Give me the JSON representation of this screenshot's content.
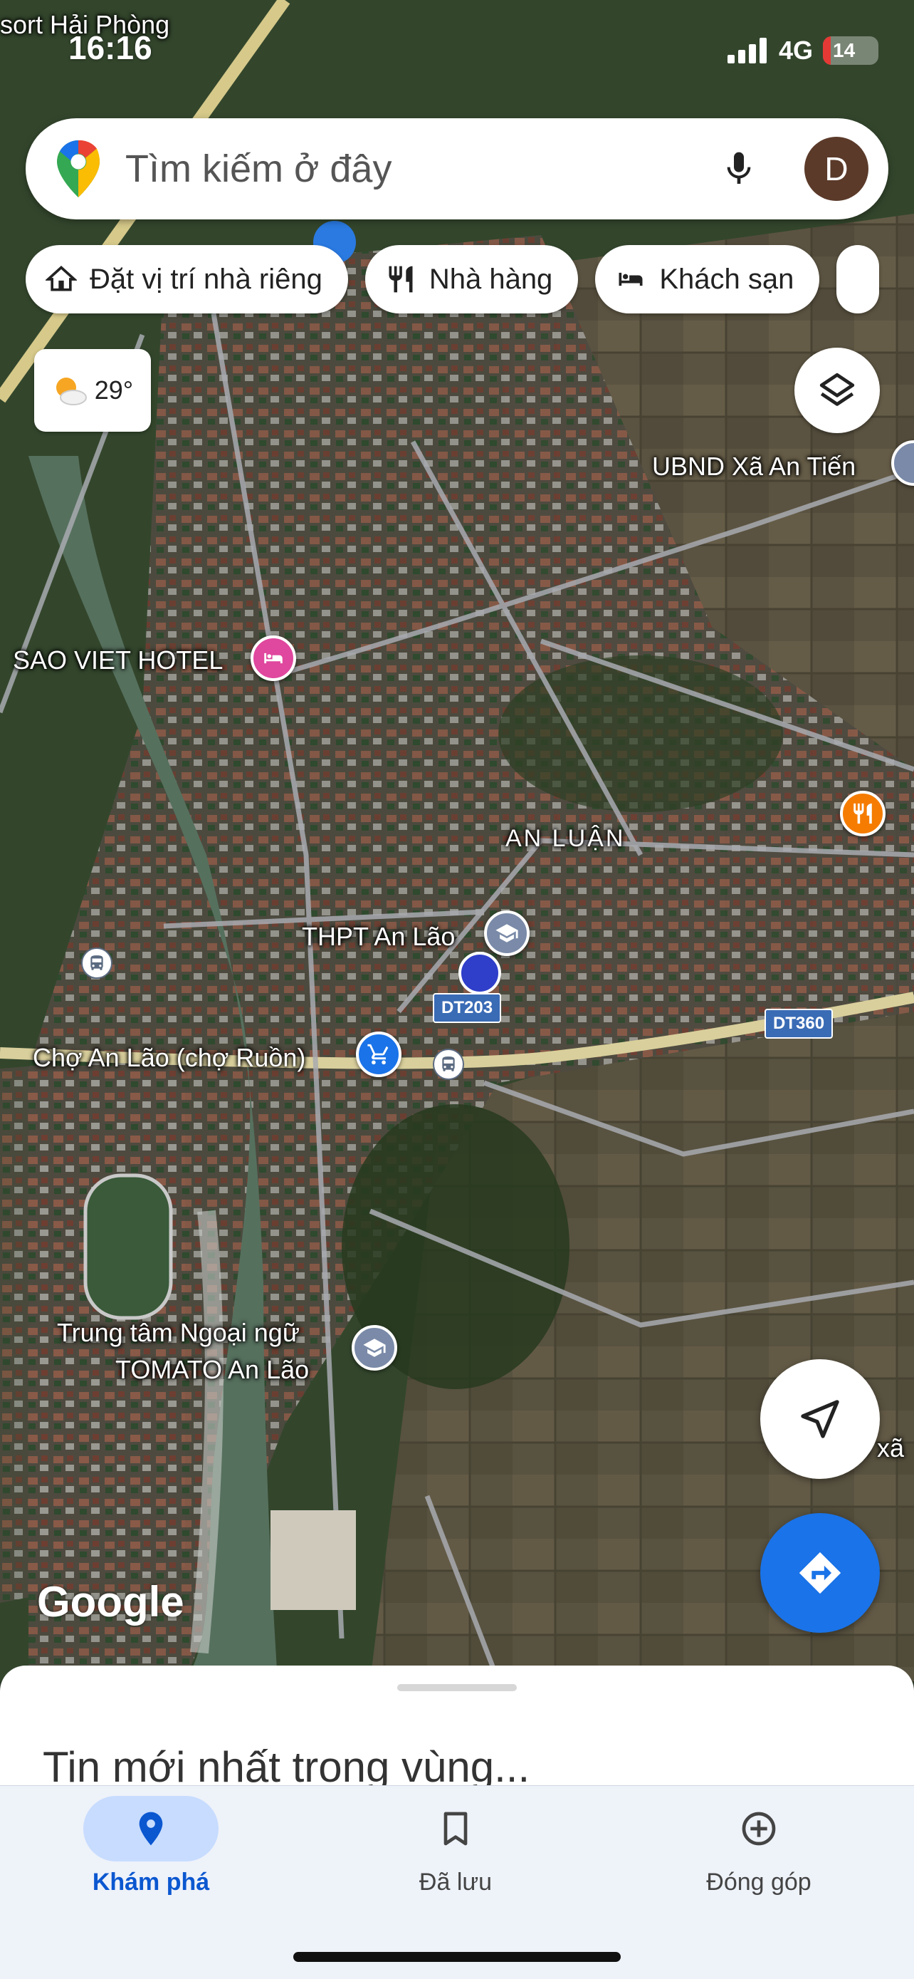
{
  "status_bar": {
    "time": "16:16",
    "network": "4G",
    "battery": "14",
    "battery_level": 0.14
  },
  "search": {
    "placeholder": "Tìm kiếm ở đây",
    "avatar_letter": "D"
  },
  "chips": [
    {
      "label": "Đặt vị trí nhà riêng",
      "icon": "home-icon"
    },
    {
      "label": "Nhà hàng",
      "icon": "restaurant-icon"
    },
    {
      "label": "Khách sạn",
      "icon": "hotel-icon"
    }
  ],
  "weather": {
    "temp": "29°",
    "icon": "partly-cloudy-icon"
  },
  "map": {
    "labels": {
      "top_left": "sort Hải Phòng",
      "ubnd": "UBND Xã An Tiến",
      "hotel": "SAO VIET HOTEL",
      "area": "AN LUẬN",
      "school": "THPT An Lão",
      "market": "Chợ An Lão (chợ Ruồn)",
      "center_line1": "Trung tâm Ngoại ngữ",
      "center_line2": "TOMATO An Lão",
      "right_cut": "D xã"
    },
    "roads": {
      "dt203": "DT203",
      "dt360": "DT360"
    },
    "colors": {
      "hotel_pin": "#e0479e",
      "school_pin": "#7a8aa8",
      "market_pin": "#1a73e8",
      "food_pin": "#f57c00"
    }
  },
  "google_logo": "Google",
  "sheet": {
    "title": "Tin mới nhất trong vùng..."
  },
  "nav": [
    {
      "label": "Khám phá",
      "icon": "explore-pin-icon",
      "active": true
    },
    {
      "label": "Đã lưu",
      "icon": "bookmark-icon",
      "active": false
    },
    {
      "label": "Đóng góp",
      "icon": "add-circle-icon",
      "active": false
    }
  ]
}
